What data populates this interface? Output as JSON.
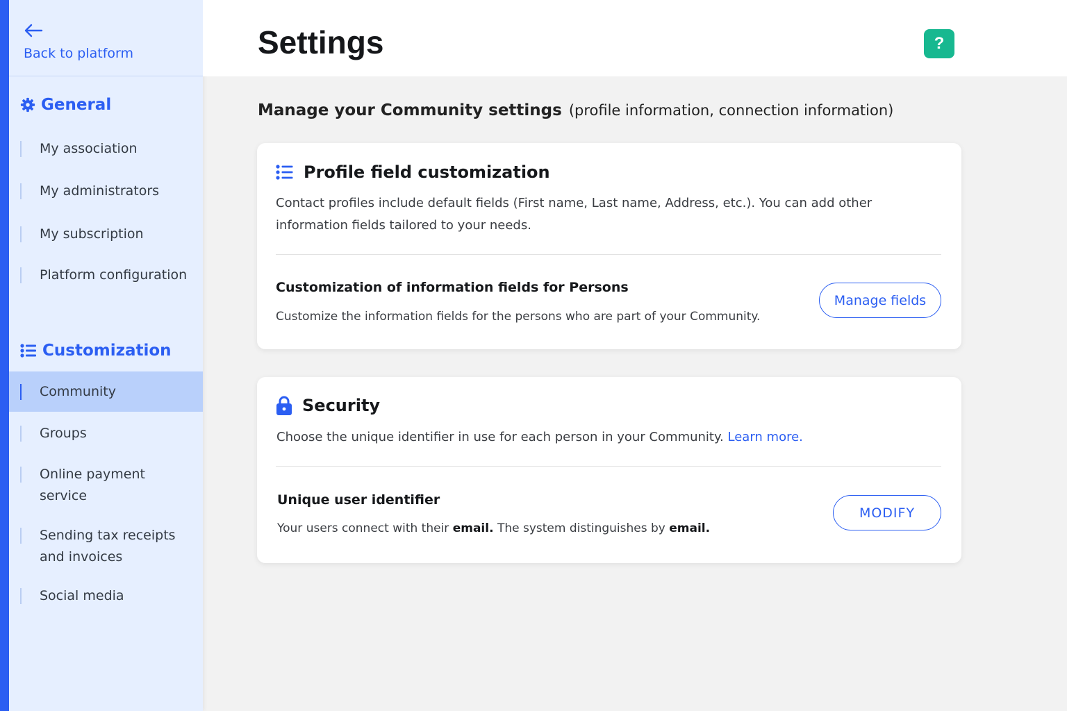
{
  "sidebar": {
    "back_label": "Back to platform",
    "sections": {
      "general": {
        "title": "General",
        "items": [
          "My association",
          "My administrators",
          "My subscription",
          "Platform configuration"
        ]
      },
      "customization": {
        "title": "Customization",
        "items": [
          "Community",
          "Groups",
          "Online payment service",
          "Sending tax receipts and invoices",
          "Social media"
        ],
        "active": "Community"
      }
    }
  },
  "header": {
    "title": "Settings",
    "help_label": "?"
  },
  "main": {
    "intro_strong": "Manage your Community settings",
    "intro_rest": "(profile information, connection information)",
    "profile_card": {
      "title": "Profile field customization",
      "description": "Contact profiles include default fields (First name, Last name, Address, etc.). You can add other information fields tailored to your needs.",
      "sub_title": "Customization of information fields for Persons",
      "sub_description": "Customize the information fields for the persons who are part of your Community.",
      "button_label": "Manage fields"
    },
    "security_card": {
      "title": "Security",
      "description": "Choose the unique identifier in use for each person in your Community.",
      "learn_more": "Learn more.",
      "sub_title": "Unique user identifier",
      "sub_description_1": "Your users connect with their",
      "sub_description_email_1": "email.",
      "sub_description_2": "The system distinguishes by",
      "sub_description_email_2": "email.",
      "button_label": "MODIFY"
    }
  },
  "colors": {
    "accent": "#2b5ef2",
    "sidebar_bg": "#e6efff",
    "active_item_bg": "#b9d0fb",
    "help_green": "#17b890"
  }
}
